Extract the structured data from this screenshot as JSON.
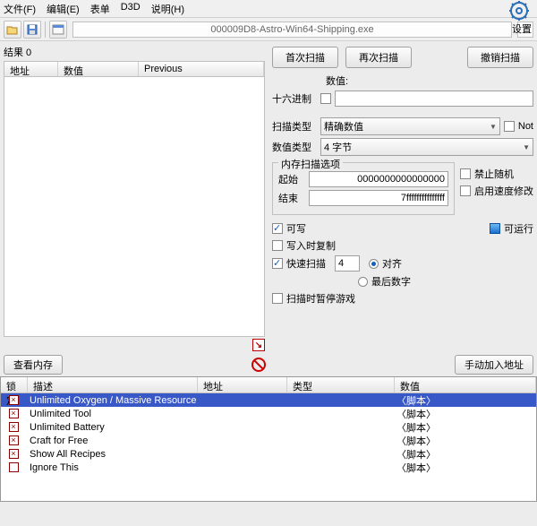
{
  "menu": {
    "file": "文件(F)",
    "edit": "编辑(E)",
    "table": "表单",
    "d3d": "D3D",
    "help": "说明(H)"
  },
  "title": "000009D8-Astro-Win64-Shipping.exe",
  "settings_label": "设置",
  "results_label": "结果 0",
  "result_headers": {
    "addr": "地址",
    "value": "数值",
    "prev": "Previous"
  },
  "buttons": {
    "first_scan": "首次扫描",
    "next_scan": "再次扫描",
    "undo_scan": "撤销扫描",
    "view_mem": "查看内存",
    "manual_add": "手动加入地址"
  },
  "labels": {
    "value": "数值:",
    "hex": "十六进制",
    "scan_type": "扫描类型",
    "value_type": "数值类型",
    "not": "Not",
    "mem_opt": "内存扫描选项",
    "start": "起始",
    "end": "结束",
    "writable": "可写",
    "runnable": "可运行",
    "copy_on_write": "写入时复制",
    "fast_scan": "快速扫描",
    "aligned": "对齐",
    "last_digit": "最后数字",
    "pause_game": "扫描时暂停游戏",
    "no_random": "禁止随机",
    "speed_hack": "启用速度修改"
  },
  "fields": {
    "value": "",
    "scan_type": "精确数值",
    "value_type": "4 字节",
    "start_addr": "0000000000000000",
    "end_addr": "7fffffffffffffff",
    "fast_val": "4"
  },
  "table_headers": {
    "lock": "锁定",
    "desc": "描述",
    "addr": "地址",
    "type": "类型",
    "value": "数值"
  },
  "rows": [
    {
      "x": true,
      "desc": "Unlimited Oxygen / Massive Resources",
      "val": "脚本",
      "sel": true
    },
    {
      "x": true,
      "desc": "Unlimited Tool",
      "val": "脚本"
    },
    {
      "x": true,
      "desc": "Unlimited Battery",
      "val": "脚本"
    },
    {
      "x": true,
      "desc": "Craft for Free",
      "val": "脚本"
    },
    {
      "x": true,
      "desc": "Show All Recipes",
      "val": "脚本"
    },
    {
      "x": false,
      "desc": "Ignore This",
      "val": "脚本"
    }
  ]
}
